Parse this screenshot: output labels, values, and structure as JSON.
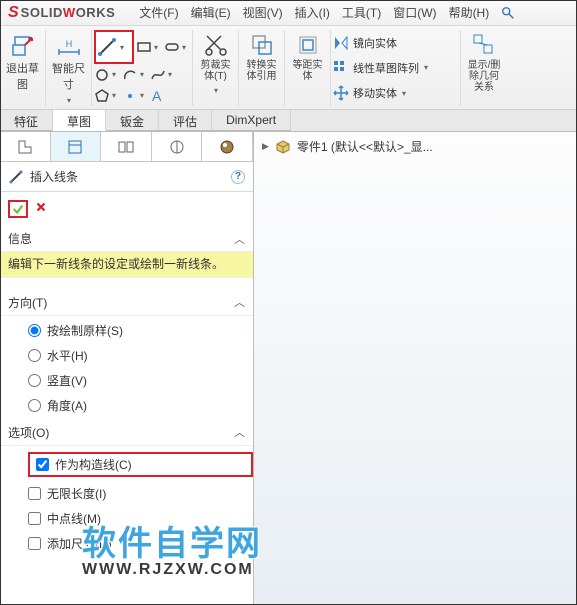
{
  "app": {
    "brand_pre": "SOLID",
    "brand_post": "ORKS"
  },
  "menus": [
    "文件(F)",
    "编辑(E)",
    "视图(V)",
    "插入(I)",
    "工具(T)",
    "窗口(W)",
    "帮助(H)"
  ],
  "ribbon": {
    "exit_sketch": "退出草图",
    "smart_dim": "智能尺寸",
    "trim": "剪裁实体(T)",
    "convert": "转换实体引用",
    "offset": "等距实体",
    "mirror": "镜向实体",
    "lpattern": "线性草图阵列",
    "move": "移动实体",
    "display": "显示/删除几何关系"
  },
  "tabs": [
    "特征",
    "草图",
    "钣金",
    "评估",
    "DimXpert"
  ],
  "active_tab": 1,
  "panel": {
    "title": "插入线条",
    "info_title": "信息",
    "info_msg": "编辑下一新线条的设定或绘制一新线条。",
    "dir_title": "方向(T)",
    "dir_opts": [
      "按绘制原样(S)",
      "水平(H)",
      "竖直(V)",
      "角度(A)"
    ],
    "opt_title": "选项(O)",
    "opt_items": [
      "作为构造线(C)",
      "无限长度(I)",
      "中点线(M)",
      "添加尺寸(D)"
    ]
  },
  "breadcrumb": "零件1  (默认<<默认>_显...",
  "watermark": {
    "main": "软件自学网",
    "url": "WWW.RJZXW.COM"
  }
}
